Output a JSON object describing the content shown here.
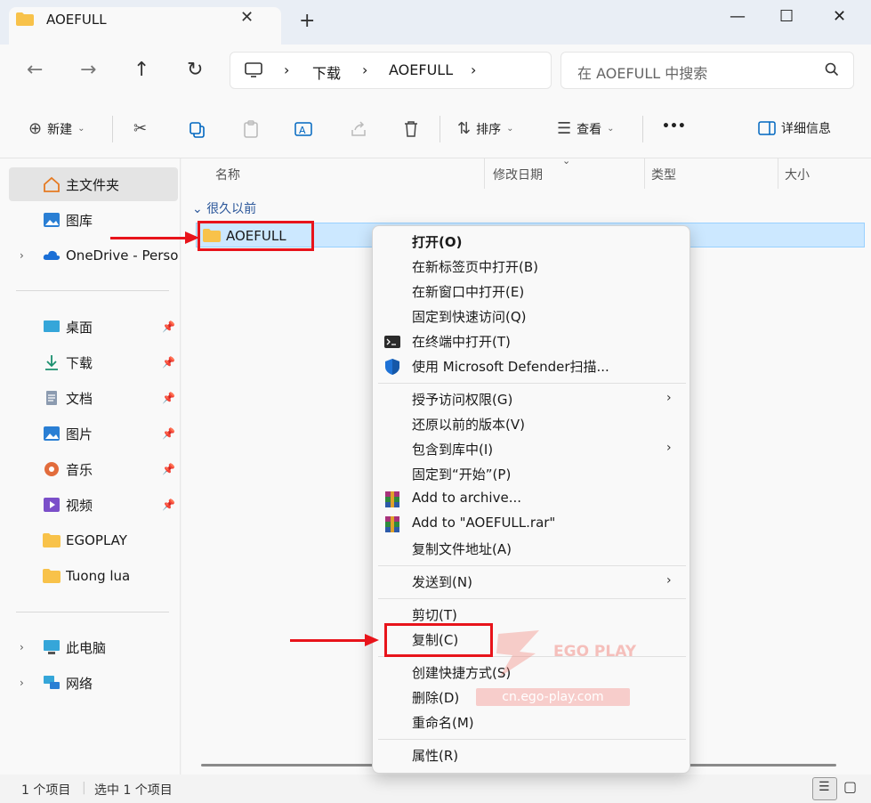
{
  "window": {
    "tab_title": "AOEFULL",
    "tab_close": "✕",
    "tab_add": "+",
    "minimize": "—",
    "maximize": "☐",
    "close": "✕"
  },
  "nav": {
    "back": "←",
    "forward": "→",
    "up": "↑",
    "refresh": "↻",
    "breadcrumb": [
      "下载",
      "AOEFULL"
    ],
    "sep": "›",
    "search_placeholder": "在 AOEFULL 中搜索"
  },
  "toolbar": {
    "new_label": "新建",
    "sort_label": "排序",
    "view_label": "查看",
    "more_label": "•••",
    "details_label": "详细信息"
  },
  "sidebar": {
    "home": "主文件夹",
    "gallery": "图库",
    "onedrive": "OneDrive - Personal",
    "desktop": "桌面",
    "downloads": "下载",
    "documents": "文档",
    "pictures": "图片",
    "music": "音乐",
    "videos": "视频",
    "egoplay": "EGOPLAY",
    "tuongl": "Tuong lua",
    "thispc": "此电脑",
    "network": "网络"
  },
  "content": {
    "columns": {
      "name": "名称",
      "modified": "修改日期",
      "type": "类型",
      "size": "大小"
    },
    "group": "很久以前",
    "item_name": "AOEFULL"
  },
  "status": {
    "count": "1 个项目",
    "selected": "选中 1 个项目"
  },
  "menu": {
    "open": "打开(O)",
    "open_new_tab": "在新标签页中打开(B)",
    "open_new_window": "在新窗口中打开(E)",
    "pin_quick": "固定到快速访问(Q)",
    "open_terminal": "在终端中打开(T)",
    "defender": "使用 Microsoft Defender扫描...",
    "grant_access": "授予访问权限(G)",
    "restore": "还原以前的版本(V)",
    "include_library": "包含到库中(I)",
    "pin_start": "固定到“开始”(P)",
    "add_archive": "Add to archive...",
    "add_rar": "Add to \"AOEFULL.rar\"",
    "copy_path": "复制文件地址(A)",
    "send_to": "发送到(N)",
    "cut": "剪切(T)",
    "copy": "复制(C)",
    "create_shortcut": "创建快捷方式(S)",
    "delete": "删除(D)",
    "rename": "重命名(M)",
    "properties": "属性(R)",
    "submenu_arrow": "›"
  },
  "watermark": {
    "brand": "EGO PLAY",
    "url": "cn.ego-play.com"
  },
  "colors": {
    "accent": "#0067c0",
    "selection": "#cce8ff",
    "annotation": "#e8141b",
    "folder": "#f8c24a"
  }
}
